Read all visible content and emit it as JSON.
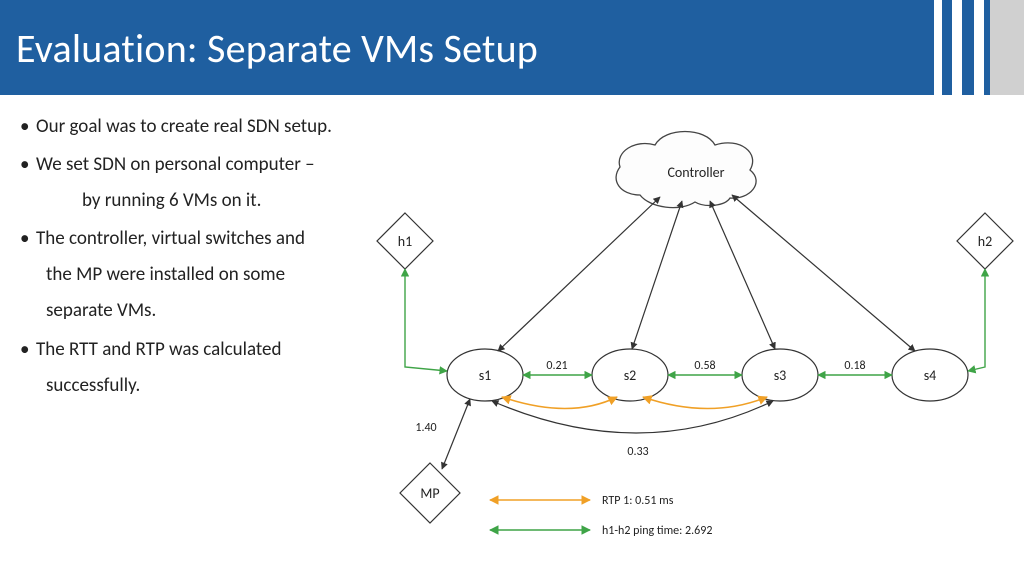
{
  "header": {
    "title": "Evaluation:  Separate VMs Setup"
  },
  "bullets": {
    "b1": "Our goal was to create real SDN setup.",
    "b2": "We set SDN on personal computer –",
    "b2_sub": "by running 6 VMs on it.",
    "b3": "The controller, virtual switches and",
    "b3_c1": "the MP were installed on some",
    "b3_c2": "separate VMs.",
    "b4": "The RTT and RTP was calculated",
    "b4_c1": "successfully."
  },
  "diagram": {
    "controller": "Controller",
    "h1": "h1",
    "h2": "h2",
    "s1": "s1",
    "s2": "s2",
    "s3": "s3",
    "s4": "s4",
    "mp": "MP",
    "e_s1_s2": "0.21",
    "e_s2_s3": "0.58",
    "e_s3_s4": "0.18",
    "e_mp_s1": "1.40",
    "e_bottom": "0.33",
    "legend_rtp": "RTP 1:   0.51 ms",
    "legend_ping": "h1-h2 ping time: 2.692"
  }
}
